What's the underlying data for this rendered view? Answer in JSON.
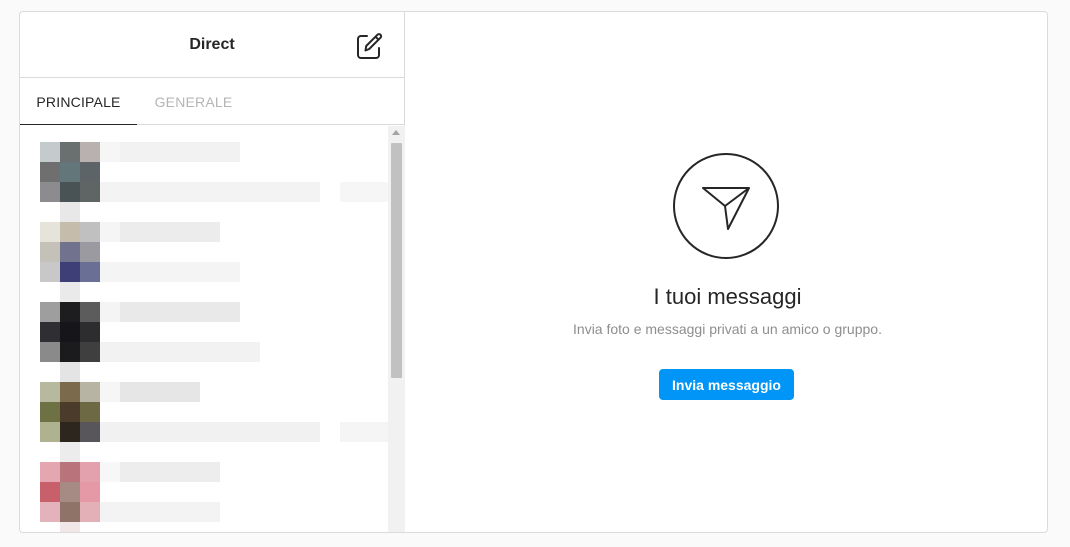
{
  "header": {
    "title": "Direct",
    "compose_icon": "edit-square-icon"
  },
  "tabs": [
    {
      "label": "PRINCIPALE",
      "active": true
    },
    {
      "label": "GENERALE",
      "active": false
    }
  ],
  "conversations": [
    {
      "avatar": [
        "#c4cbcd",
        "#6a6f70",
        "#b9b1b0",
        "#6f6f70",
        "#637679",
        "#5c6468",
        "#8c8c8e",
        "#495254",
        "#5f6465"
      ],
      "below": "#e8e8e8"
    },
    {
      "avatar": [
        "#e6e4da",
        "#c5bcac",
        "#c0c0c0",
        "#c4c2b8",
        "#71738e",
        "#9a9aa0",
        "#c8c8c8",
        "#3e3f77",
        "#6a6f96"
      ],
      "below": "#eaeaea"
    },
    {
      "avatar": [
        "#9e9e9e",
        "#1d1d20",
        "#5c5c5c",
        "#2f2f33",
        "#15151a",
        "#2d2d2f",
        "#8a8a8a",
        "#1b1b1e",
        "#3f3f40"
      ],
      "below": "#e4e4e4"
    },
    {
      "avatar": [
        "#b7b99e",
        "#7c6a4d",
        "#b8b4a4",
        "#6d7143",
        "#4a3b2b",
        "#6d6945",
        "#aeb28f",
        "#2d261e",
        "#58565a"
      ],
      "below": "#ececec"
    },
    {
      "avatar": [
        "#e4a6b0",
        "#b9737a",
        "#e3a1ad",
        "#c8606c",
        "#a68b85",
        "#e599a7",
        "#e4b2bb",
        "#8f7268",
        "#e3b0b8"
      ],
      "below": "#f1e7e8"
    }
  ],
  "empty_state": {
    "icon": "paper-plane-icon",
    "title": "I tuoi messaggi",
    "subtitle": "Invia foto e messaggi privati a un amico o gruppo.",
    "button_label": "Invia messaggio"
  },
  "colors": {
    "accent": "#0095f6",
    "border": "#dbdbdb",
    "muted": "#8e8e8e"
  }
}
